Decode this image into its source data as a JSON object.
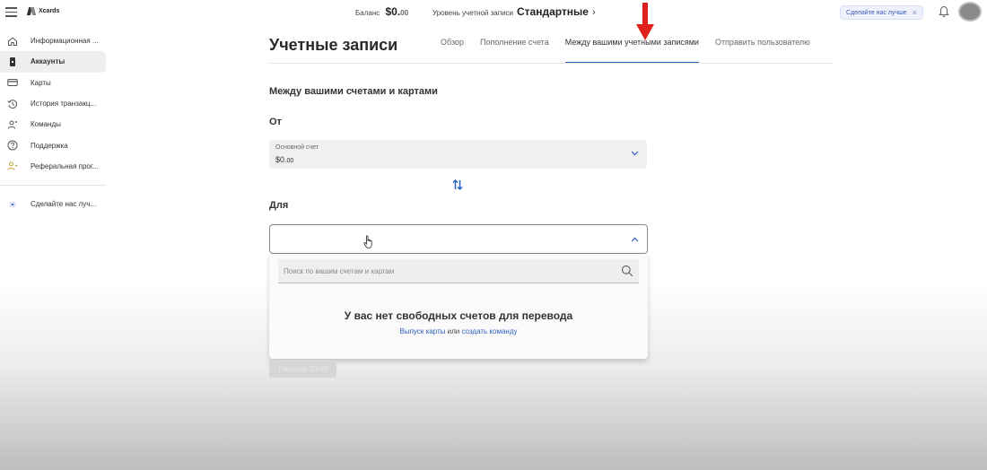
{
  "header": {
    "logo_text": "Xcards",
    "balance_label": "Баланс",
    "balance_amount": "$0.",
    "balance_cents": "00",
    "account_level_label": "Уровень учетной записи",
    "account_level_value": "Стандартные",
    "promo_chip": "Сделайте нас лучше"
  },
  "sidebar": {
    "items": [
      {
        "label": "Информационная ...",
        "icon": "home-icon"
      },
      {
        "label": "Аккаунты",
        "icon": "wallet-icon",
        "active": true
      },
      {
        "label": "Карты",
        "icon": "card-icon"
      },
      {
        "label": "История транзакц...",
        "icon": "history-icon"
      },
      {
        "label": "Команды",
        "icon": "team-icon"
      },
      {
        "label": "Поддержка",
        "icon": "help-icon"
      },
      {
        "label": "Реферальная прог...",
        "icon": "referral-icon"
      }
    ],
    "feedback": {
      "label": "Сделайте нас луч...",
      "icon": "feedback-icon"
    }
  },
  "main": {
    "title": "Учетные записи",
    "tabs": [
      {
        "label": "Обзор"
      },
      {
        "label": "Пополнение счета"
      },
      {
        "label": "Между вашими учетными записями",
        "active": true
      },
      {
        "label": "Отправить пользователю"
      }
    ],
    "section_title": "Между вашими счетами и картами",
    "from_label": "От",
    "from_select": {
      "caption": "Основной счет",
      "value": "$0.",
      "value_cents": "00"
    },
    "to_label": "Для",
    "dropdown": {
      "search_placeholder": "Поиск по вашим счетам и картам",
      "empty_message": "У вас нет свободных счетов для перевода",
      "link_issue": "Выпуск карты",
      "link_or": "или",
      "link_team": "создать команду"
    },
    "transfer_button": "Перевод $0.00"
  },
  "colors": {
    "accent": "#2f61c0",
    "annotation_arrow": "#e0201c"
  }
}
